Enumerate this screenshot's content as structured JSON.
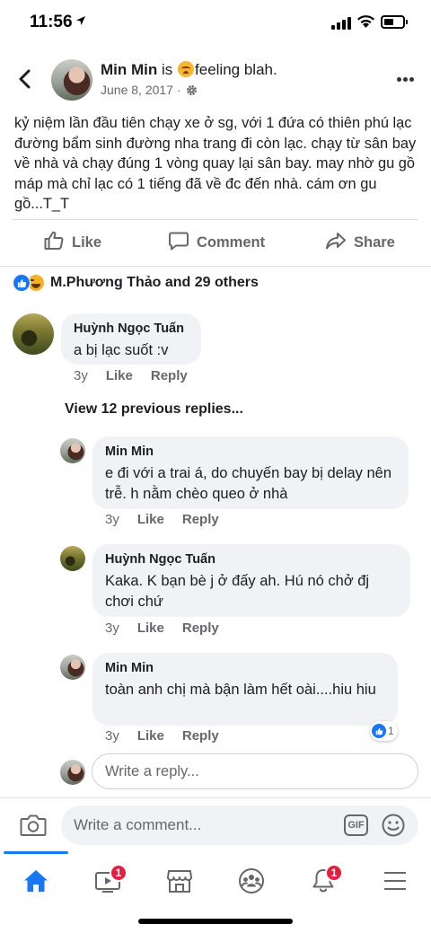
{
  "status_bar": {
    "time": "11:56",
    "battery_level": 0.4
  },
  "post": {
    "author": "Min Min",
    "feeling_prefix": "is",
    "feeling": "feeling blah.",
    "date": "June 8, 2017",
    "privacy_icon": "gear-icon",
    "text": "kỷ niệm lần đầu tiên chạy xe ở sg, với 1 đứa có thiên phú lạc đường bẩm sinh đường nha trang đi còn lạc. chạy từ sân bay về nhà và chạy đúng 1 vòng quay lại sân bay. may nhờ gu gồ máp mà  chỉ lạc có 1 tiếng đã về đc đến nhà. cám ơn gu gồ...T_T"
  },
  "actions": {
    "like": "Like",
    "comment": "Comment",
    "share": "Share"
  },
  "reactions": {
    "summary": "M.Phương Thảo and 29 others"
  },
  "comments": [
    {
      "author": "Huỳnh Ngọc Tuấn",
      "text": "a bị lạc suốt :v",
      "time": "3y",
      "like": "Like",
      "reply": "Reply"
    }
  ],
  "view_previous": "View 12 previous replies...",
  "replies": [
    {
      "author": "Min Min",
      "text": "e đi với a trai á, do chuyến bay bị delay nên trễ. h nằm chèo queo ở nhà",
      "time": "3y",
      "like": "Like",
      "reply": "Reply"
    },
    {
      "author": "Huỳnh Ngọc Tuấn",
      "text": "Kaka. K bạn bè j ở đấy ah. Hú nó chở đj chơi chứ",
      "time": "3y",
      "like": "Like",
      "reply": "Reply"
    },
    {
      "author": "Min Min",
      "text": "toàn anh chị mà bận làm hết oài....hiu hiu",
      "time": "3y",
      "like": "Like",
      "reply": "Reply",
      "reaction_count": "1"
    }
  ],
  "reply_placeholder": "Write a reply...",
  "composer": {
    "placeholder": "Write a comment...",
    "gif": "GIF"
  },
  "tabbar": {
    "video_badge": "1",
    "notifications_badge": "1"
  },
  "colors": {
    "accent": "#1877f2",
    "badge": "#e41e3f",
    "bubble": "#f0f2f5",
    "muted": "#65676b"
  }
}
